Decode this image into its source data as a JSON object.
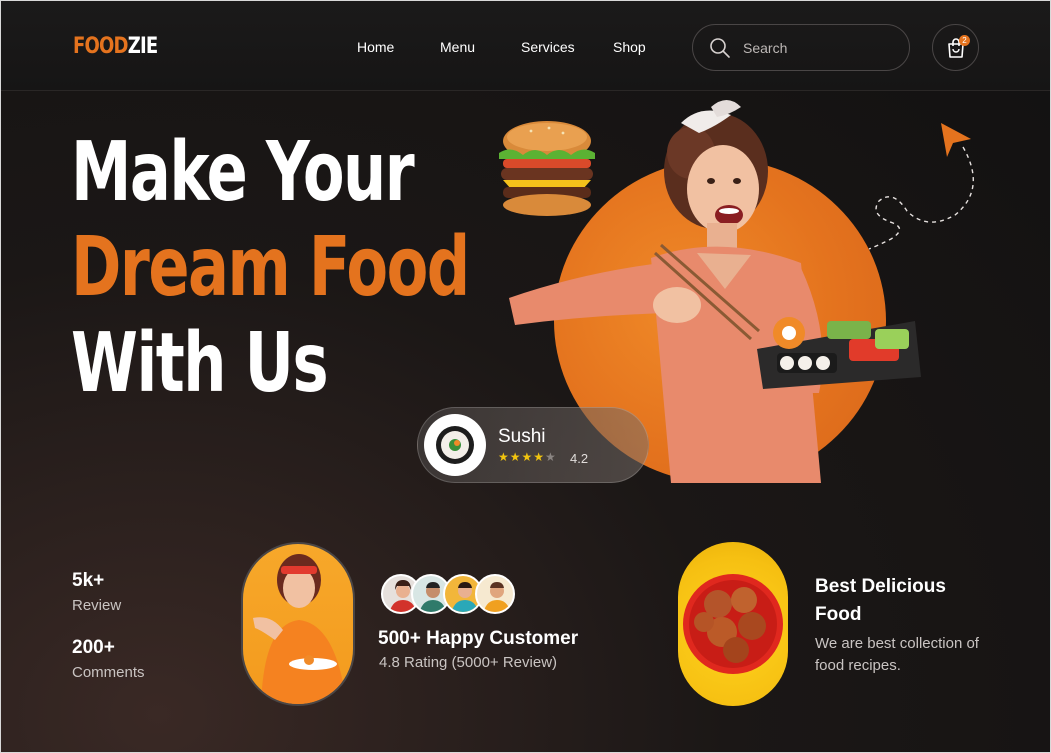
{
  "brand": {
    "part1": "FOOD",
    "part2": "ZIE",
    "accent": "#e4731e"
  },
  "nav": {
    "items": [
      "Home",
      "Menu",
      "Services",
      "Shop"
    ]
  },
  "search": {
    "placeholder": "Search",
    "icon": "search-icon"
  },
  "cart": {
    "icon": "shopping-bag-icon",
    "count": "2"
  },
  "hero": {
    "line1": "Make Your",
    "line2": "Dream Food",
    "line3": "With Us"
  },
  "sushi_card": {
    "name": "Sushi",
    "rating": "4.2",
    "stars_filled": 4,
    "stars_total": 5
  },
  "stats": [
    {
      "value": "5k+",
      "label": "Review"
    },
    {
      "value": "200+",
      "label": "Comments"
    }
  ],
  "customers": {
    "title": "500+ Happy Customer",
    "subtitle": "4.8 Rating (5000+ Review)"
  },
  "feature": {
    "title": "Best Delicious Food",
    "description": "We are best collection of food recipes."
  },
  "colors": {
    "orange": "#e4731e",
    "yellow": "#f6c012",
    "bg": "#141212"
  }
}
